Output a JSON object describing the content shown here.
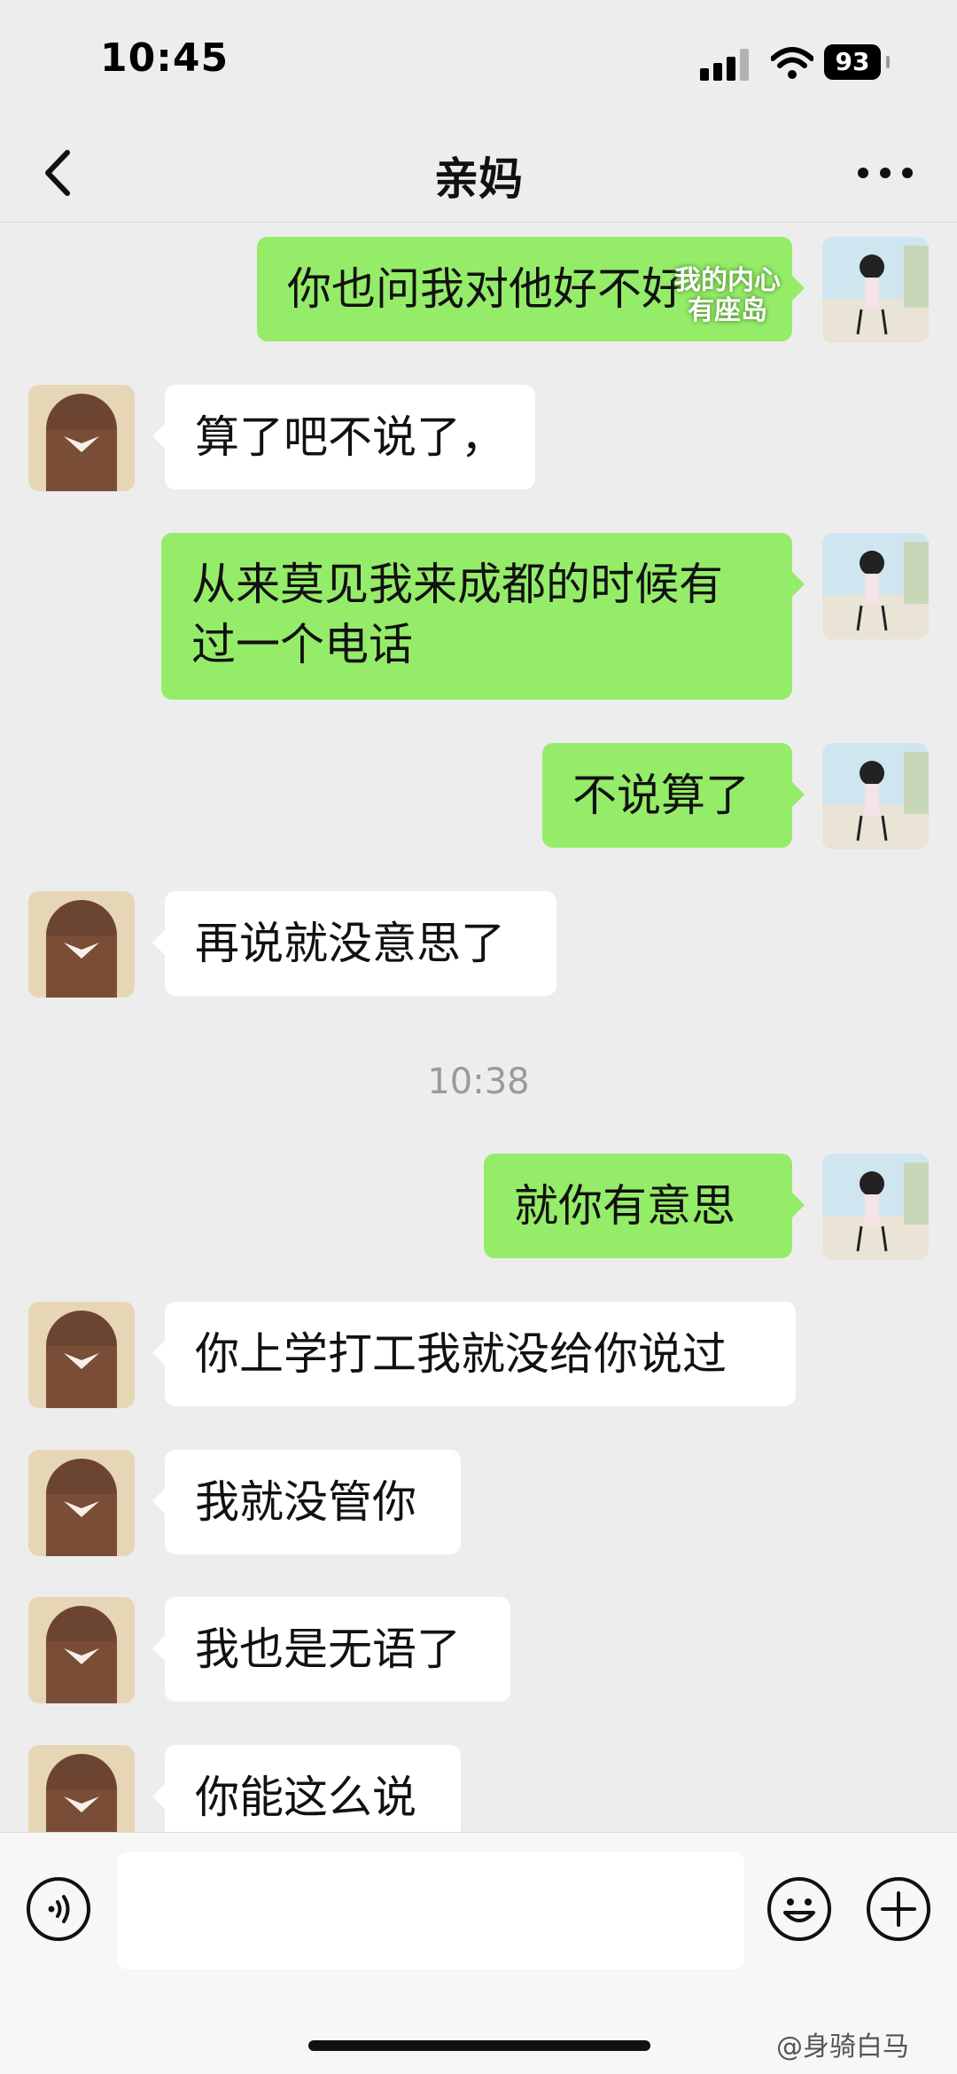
{
  "status_bar": {
    "time": "10:45",
    "battery": "93"
  },
  "header": {
    "back_icon": "chevron-left-icon",
    "title": "亲妈",
    "more_icon": "more-dots-icon"
  },
  "sticker_overlay": {
    "line1": "我的内心",
    "line2": "有座岛"
  },
  "messages": [
    {
      "side": "out",
      "text": "你也问我对他好不好"
    },
    {
      "side": "in",
      "text": "算了吧不说了，"
    },
    {
      "side": "out",
      "text": "从来莫见我来成都的时候有过一个电话"
    },
    {
      "side": "out",
      "text": "不说算了"
    },
    {
      "side": "in",
      "text": "再说就没意思了"
    },
    {
      "type": "time",
      "text": "10:38"
    },
    {
      "side": "out",
      "text": "就你有意思"
    },
    {
      "side": "in",
      "text": "你上学打工我就没给你说过"
    },
    {
      "side": "in",
      "text": "我就没管你"
    },
    {
      "side": "in",
      "text": "我也是无语了"
    },
    {
      "side": "in",
      "text": "你能这么说"
    }
  ],
  "input_bar": {
    "voice_icon": "voice-icon",
    "placeholder": "",
    "emoji_icon": "emoji-icon",
    "plus_icon": "plus-icon"
  },
  "watermark": "@身骑白马",
  "colors": {
    "sent_bubble": "#95ec69",
    "received_bubble": "#ffffff",
    "background": "#ededed"
  }
}
